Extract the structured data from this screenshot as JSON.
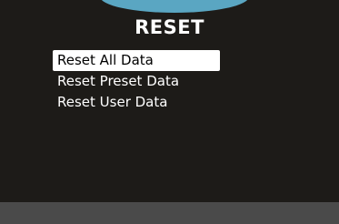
{
  "header": {
    "title": "RESET"
  },
  "menu": {
    "items": [
      {
        "label": "Reset All Data",
        "selected": true
      },
      {
        "label": "Reset Preset Data",
        "selected": false
      },
      {
        "label": "Reset User Data",
        "selected": false
      }
    ]
  },
  "colors": {
    "background": "#1d1b18",
    "accent": "#5aa6c2",
    "selection": "#ffffff",
    "footer": "#4a4a4a"
  }
}
